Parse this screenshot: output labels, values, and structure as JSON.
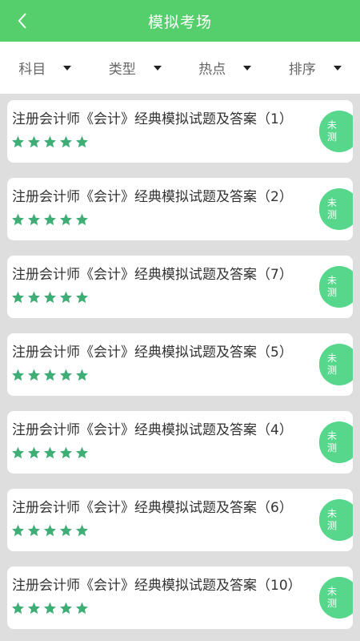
{
  "header": {
    "title": "模拟考场"
  },
  "filters": [
    {
      "label": "科目"
    },
    {
      "label": "类型"
    },
    {
      "label": "热点"
    },
    {
      "label": "排序"
    }
  ],
  "colors": {
    "header": "#55cf6b",
    "star": "#3fae76",
    "badge": "#56d78c"
  },
  "items": [
    {
      "title": "注册会计师《会计》经典模拟试题及答案（1）",
      "rating": 5,
      "status": "未测"
    },
    {
      "title": "注册会计师《会计》经典模拟试题及答案（2）",
      "rating": 5,
      "status": "未测"
    },
    {
      "title": "注册会计师《会计》经典模拟试题及答案（7）",
      "rating": 5,
      "status": "未测"
    },
    {
      "title": "注册会计师《会计》经典模拟试题及答案（5）",
      "rating": 5,
      "status": "未测"
    },
    {
      "title": "注册会计师《会计》经典模拟试题及答案（4）",
      "rating": 5,
      "status": "未测"
    },
    {
      "title": "注册会计师《会计》经典模拟试题及答案（6）",
      "rating": 5,
      "status": "未测"
    },
    {
      "title": "注册会计师《会计》经典模拟试题及答案（10）",
      "rating": 5,
      "status": "未测"
    }
  ]
}
